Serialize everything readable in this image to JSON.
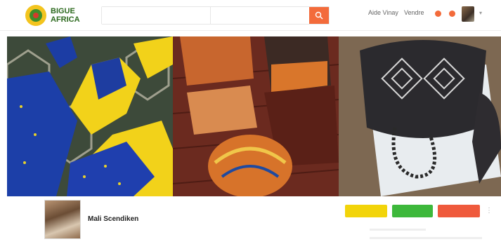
{
  "header": {
    "logo_text": "BIGUE AFRICA",
    "search_placeholder": "",
    "location_placeholder": "",
    "nav_help": "Aide Vinay",
    "nav_seller": "Vendre"
  },
  "shop": {
    "name": "Mali Scendiken",
    "location": "",
    "tag": ""
  },
  "actions": {
    "follow_label": "",
    "message_label": "",
    "report_label": ""
  },
  "colors": {
    "accent": "#f36b3b",
    "follow": "#f2d40a",
    "message": "#3db83b",
    "report": "#ef5a3c"
  }
}
